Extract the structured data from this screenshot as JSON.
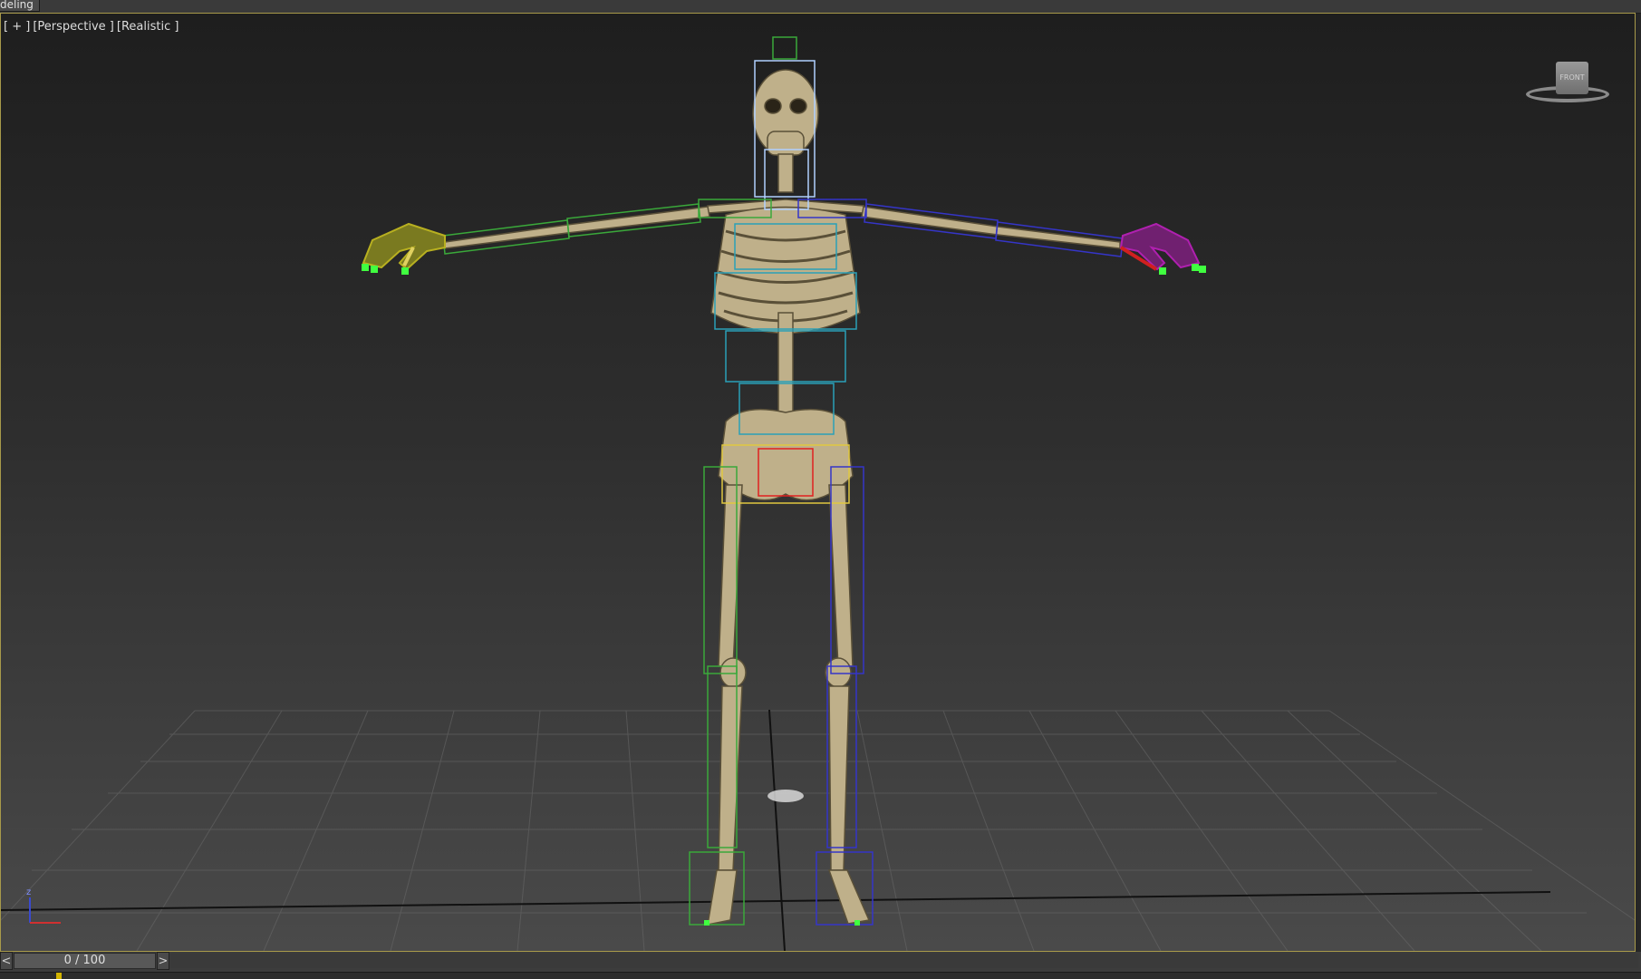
{
  "ribbon": {
    "tab_label": "deling"
  },
  "viewport": {
    "label_parts": [
      "[ + ]",
      "[Perspective ]",
      "[Realistic ]"
    ],
    "border_color": "#a89a4a"
  },
  "viewcube": {
    "face_label": "FRONT"
  },
  "axis_tripod": {
    "z_label": "z"
  },
  "time_slider": {
    "prev_label": "<",
    "next_label": ">",
    "frame_display": "0 / 100"
  },
  "scene": {
    "object": "skeleton-biped-rig",
    "colors": {
      "bone": "#bfb08a",
      "left_arm_rig": "#3aa83a",
      "right_arm_rig": "#3535c8",
      "spine_rig": "#2aa0b8",
      "pelvis_rig": "#e0c840",
      "pelvis_inner": "#e02020",
      "head_rig": "#b0d0ff",
      "left_hand": "#b8b020",
      "right_hand": "#b020b0",
      "fingertips": "#40ff40",
      "grid": "#6a6a6a"
    }
  }
}
